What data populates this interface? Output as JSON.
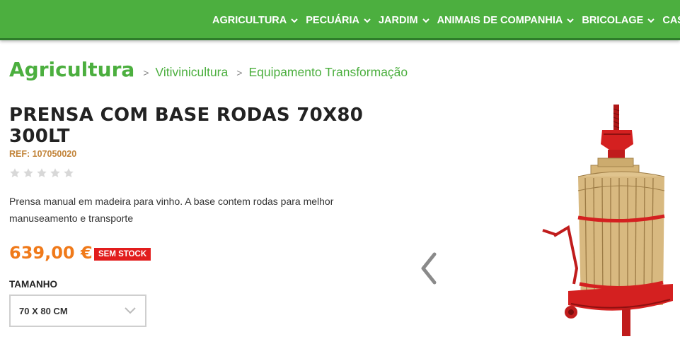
{
  "nav": {
    "items": [
      {
        "label": "AGRICULTURA",
        "icon": "chevron-down-icon"
      },
      {
        "label": "PECUÁRIA",
        "icon": "chevron-down-icon"
      },
      {
        "label": "JARDIM",
        "icon": "chevron-down-icon"
      },
      {
        "label": "ANIMAIS DE COMPANHIA",
        "icon": "chevron-down-icon"
      },
      {
        "label": "BRICOLAGE",
        "icon": "chevron-down-icon"
      },
      {
        "label": "CASA",
        "icon": "chevron-down-icon"
      }
    ],
    "color": "#4caf3f"
  },
  "breadcrumb": {
    "main": "Agricultura",
    "separator": ">",
    "links": [
      "Vitivinicultura",
      "Equipamento Transformação"
    ]
  },
  "product": {
    "title": "PRENSA COM BASE RODAS 70X80 300LT",
    "ref": "REF: 107050020",
    "rating": 0,
    "rating_max": 5,
    "description": "Prensa manual em madeira para vinho. A base contem rodas para melhor manuseamento e transporte",
    "price": "639,00 €",
    "stock_badge": "SEM STOCK",
    "size_label": "TAMANHO",
    "size_value": "70 X 80 CM",
    "price_color": "#f07a1a",
    "badge_color": "#e21d1d"
  },
  "gallery": {
    "prev_icon": "chevron-left-icon",
    "image": "wine-press-image"
  }
}
